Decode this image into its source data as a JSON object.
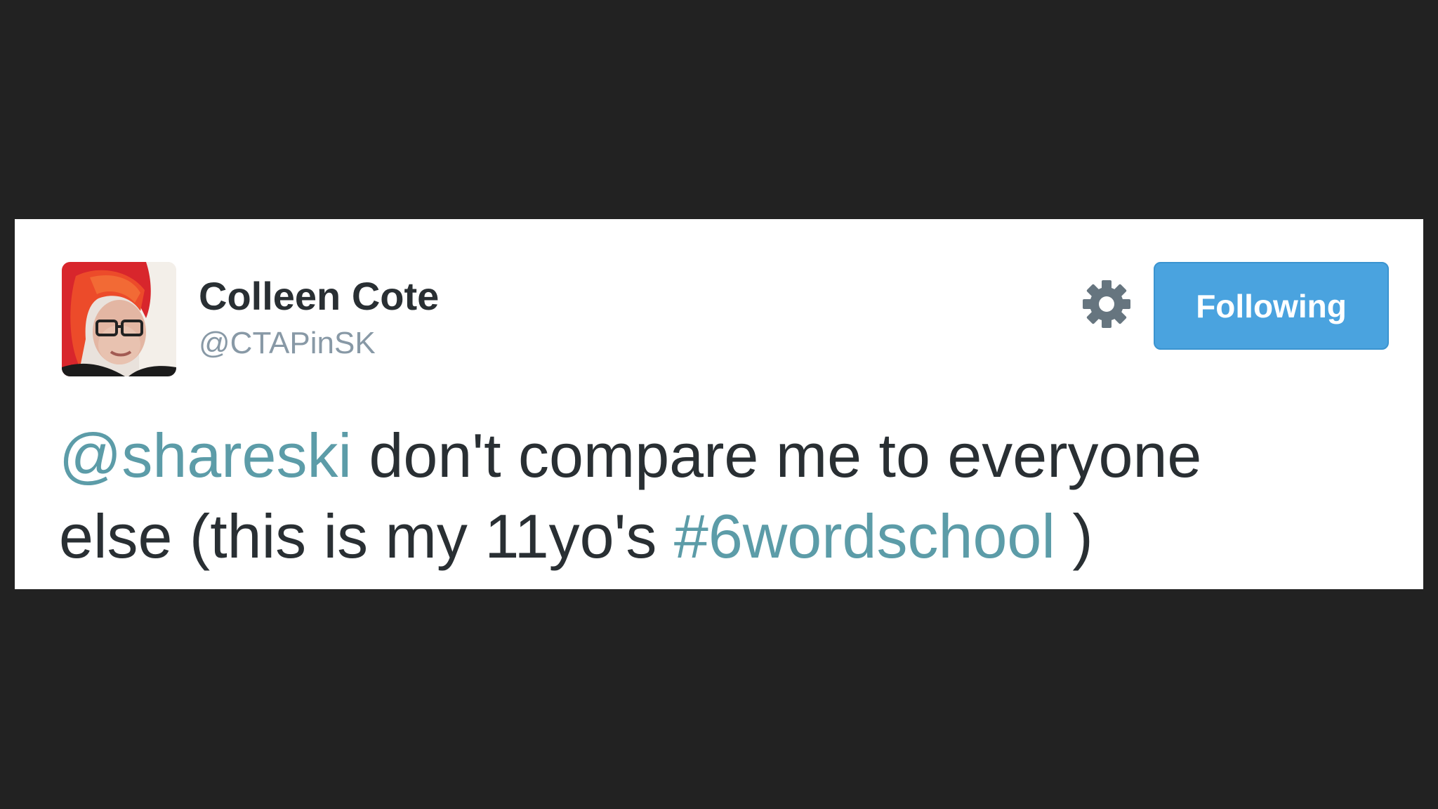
{
  "tweet": {
    "author": {
      "display_name": "Colleen Cote",
      "handle": "@CTAPinSK"
    },
    "follow_button_label": "Following",
    "text": {
      "mention": "@shareski",
      "line1_rest": " don't compare me to everyone",
      "line2_prefix": "else (this is my 11yo's ",
      "hashtag": "#6wordschool",
      "line2_suffix": " )"
    }
  },
  "icons": {
    "settings": "gear-icon",
    "avatar": "profile-photo"
  },
  "colors": {
    "background": "#222222",
    "card": "#ffffff",
    "follow_button": "#4aa3df",
    "link": "#5c9ca8",
    "text": "#292f33",
    "handle": "#8899a6"
  }
}
